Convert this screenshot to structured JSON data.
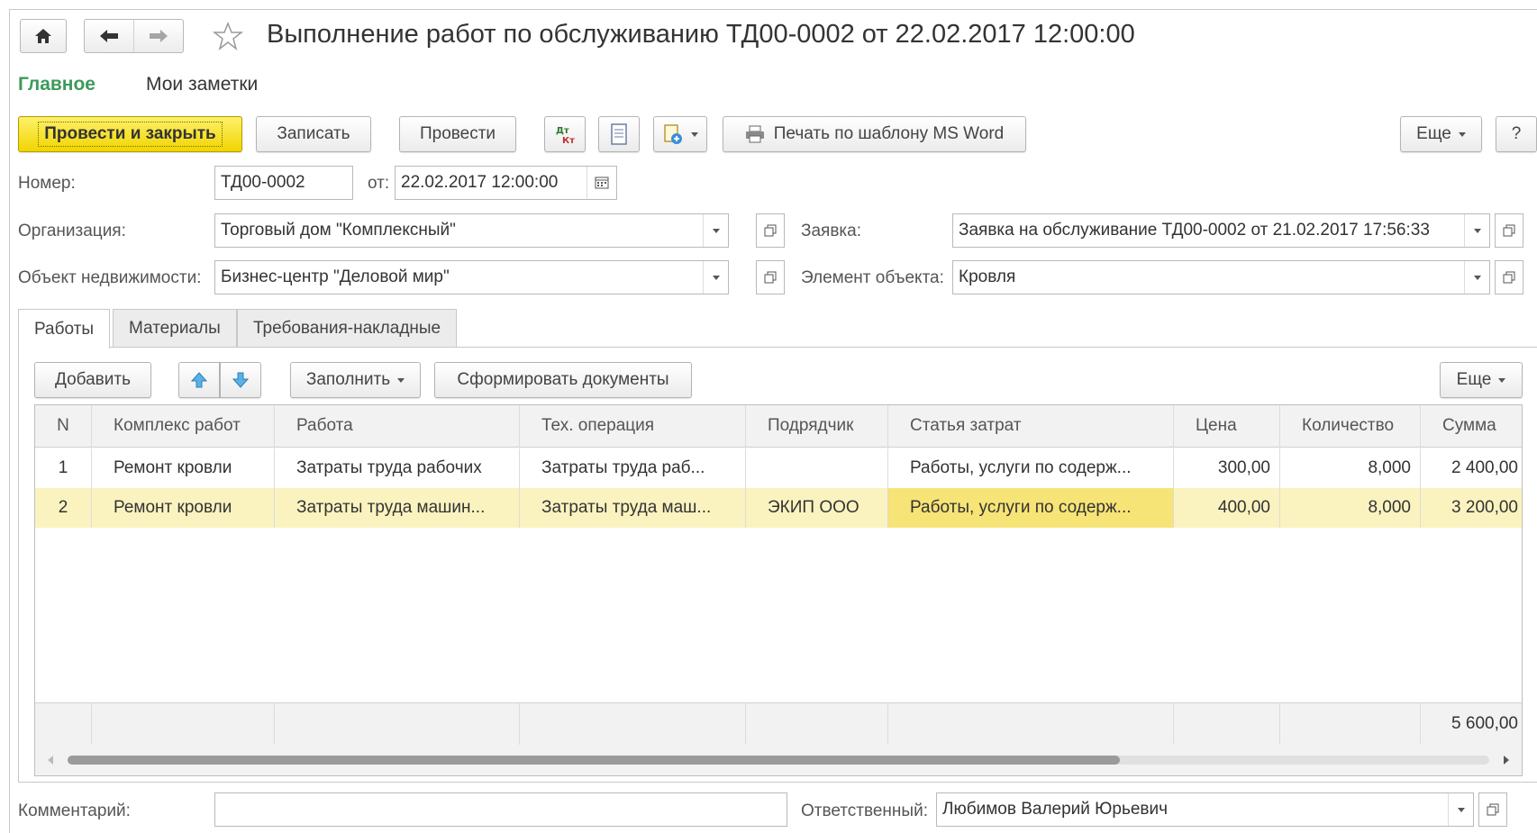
{
  "window": {
    "title": "Выполнение работ по обслуживанию ТД00-0002 от 22.02.2017 12:00:00",
    "home_icon": "home-icon",
    "back_icon": "arrow-left-icon",
    "forward_icon": "arrow-right-icon",
    "favorite_icon": "star-icon"
  },
  "sections": [
    {
      "label": "Главное",
      "active": true
    },
    {
      "label": "Мои заметки",
      "active": false
    }
  ],
  "toolbar": {
    "post_close_label": "Провести и закрыть",
    "save_label": "Записать",
    "post_label": "Провести",
    "print_word_label": "Печать по шаблону MS Word",
    "more_label": "Еще",
    "help_label": "?"
  },
  "form": {
    "number_label": "Номер:",
    "number_value": "ТД00-0002",
    "date_label": "от:",
    "date_value": "22.02.2017 12:00:00",
    "org_label": "Организация:",
    "org_value": "Торговый дом \"Комплексный\"",
    "request_label": "Заявка:",
    "request_value": "Заявка на обслуживание ТД00-0002 от 21.02.2017 17:56:33",
    "object_label": "Объект недвижимости:",
    "object_value": "Бизнес-центр \"Деловой мир\"",
    "element_label": "Элемент объекта:",
    "element_value": "Кровля",
    "comment_label": "Комментарий:",
    "comment_value": "",
    "responsible_label": "Ответственный:",
    "responsible_value": "Любимов Валерий Юрьевич"
  },
  "tabs": [
    {
      "label": "Работы",
      "active": true
    },
    {
      "label": "Материалы",
      "active": false
    },
    {
      "label": "Требования-накладные",
      "active": false
    }
  ],
  "table_toolbar": {
    "add_label": "Добавить",
    "fill_label": "Заполнить",
    "generate_label": "Сформировать документы",
    "more_label": "Еще"
  },
  "table": {
    "columns": [
      "N",
      "Комплекс работ",
      "Работа",
      "Тех. операция",
      "Подрядчик",
      "Статья затрат",
      "Цена",
      "Количество",
      "Сумма"
    ],
    "rows": [
      [
        "1",
        "Ремонт кровли",
        "Затраты труда рабочих",
        "Затраты труда раб...",
        "",
        "Работы, услуги по содерж...",
        "300,00",
        "8,000",
        "2 400,00"
      ],
      [
        "2",
        "Ремонт кровли",
        "Затраты труда машин...",
        "Затраты труда маш...",
        "ЭКИП ООО",
        "Работы, услуги по содерж...",
        "400,00",
        "8,000",
        "3 200,00"
      ]
    ],
    "selected_row": 2,
    "total_sum": "5 600,00",
    "scroll_position": 0.74
  },
  "colors": {
    "primary_button": "#f5dd1f",
    "active_section": "#3d9a5a",
    "selected_row": "#fbf3bf",
    "selected_cell": "#f7e476"
  }
}
